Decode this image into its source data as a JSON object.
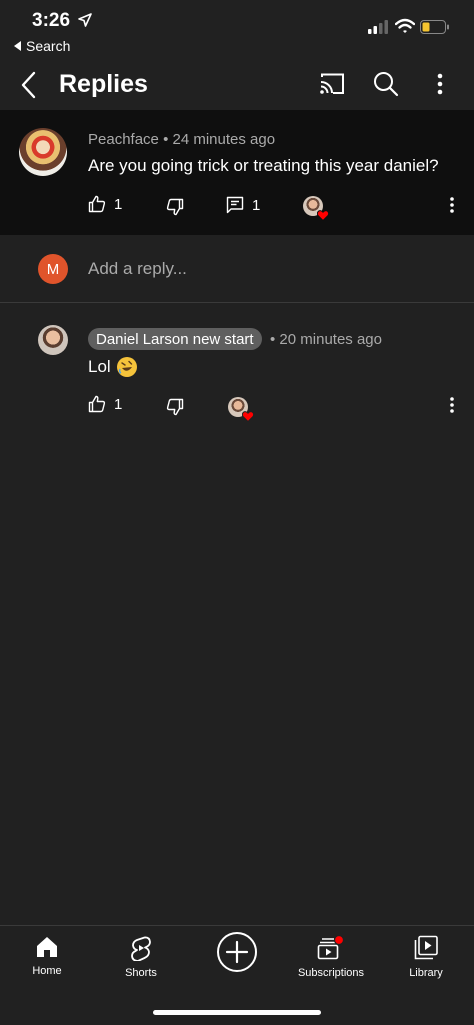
{
  "status_bar": {
    "time": "3:26",
    "back_label": "Search"
  },
  "header": {
    "title": "Replies",
    "icons": [
      "back-arrow-icon",
      "cast-icon",
      "search-icon",
      "more-vert-icon"
    ]
  },
  "top_comment": {
    "author": "Peachface",
    "time": "24 minutes ago",
    "text": "Are you going trick or treating this year daniel?",
    "likes": "1",
    "replies": "1"
  },
  "add_reply": {
    "avatar_letter": "M",
    "placeholder": "Add a reply..."
  },
  "reply": {
    "author": "Daniel Larson new start",
    "time": "20 minutes ago",
    "text": "Lol",
    "likes": "1"
  },
  "bottom_nav": {
    "items": [
      {
        "label": "Home"
      },
      {
        "label": "Shorts"
      },
      {
        "label": "Subscriptions"
      },
      {
        "label": "Library"
      }
    ]
  },
  "colors": {
    "background": "#212121",
    "comment_bg": "#0f0f0f",
    "accent_red": "#ff0000",
    "avatar_m": "#e0542b",
    "secondary_text": "#aaaaaa"
  }
}
